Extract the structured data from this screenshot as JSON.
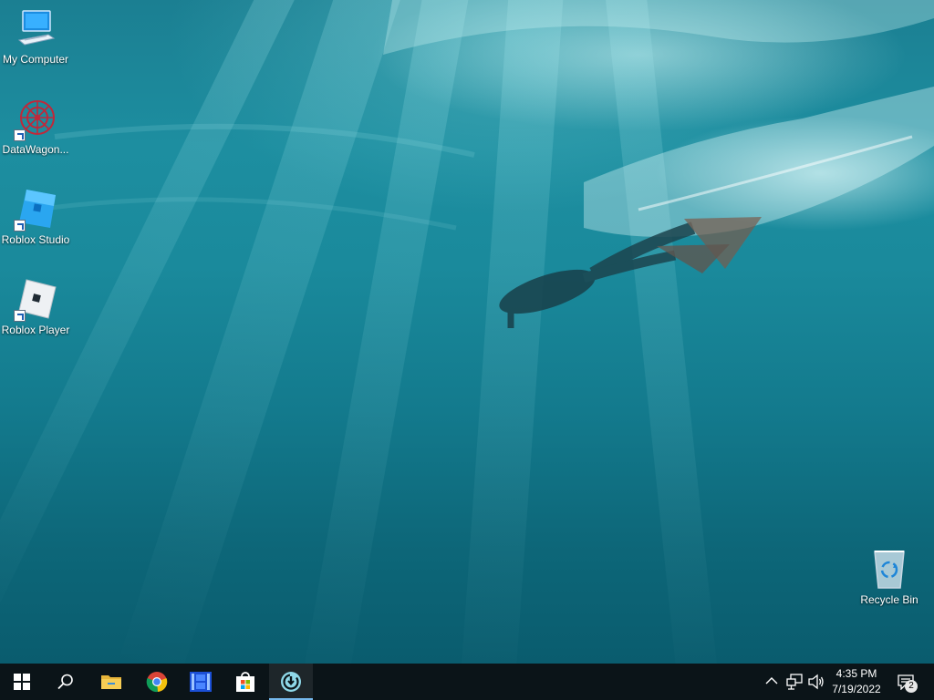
{
  "desktop": {
    "icons": [
      {
        "label": "My Computer",
        "icon": "computer-icon"
      },
      {
        "label": "DataWagon...",
        "icon": "datawagon-icon"
      },
      {
        "label": "Roblox Studio",
        "icon": "roblox-studio-icon"
      },
      {
        "label": "Roblox Player",
        "icon": "roblox-player-icon"
      },
      {
        "label": "Recycle Bin",
        "icon": "recycle-bin-icon"
      }
    ]
  },
  "taskbar": {
    "pinned": [
      {
        "icon": "windows-start-icon"
      },
      {
        "icon": "search-icon"
      },
      {
        "icon": "file-explorer-icon"
      },
      {
        "icon": "chrome-icon"
      },
      {
        "icon": "film-app-icon"
      },
      {
        "icon": "microsoft-store-icon"
      },
      {
        "icon": "active-app-icon"
      }
    ],
    "tray": {
      "time": "4:35 PM",
      "date": "7/19/2022",
      "notification_count": "2"
    }
  },
  "colors": {
    "taskbar_bg": "#0b1418",
    "water_top": "#1b7f92",
    "water_bottom": "#0a5c6e",
    "active_indicator": "#76b9ed"
  }
}
